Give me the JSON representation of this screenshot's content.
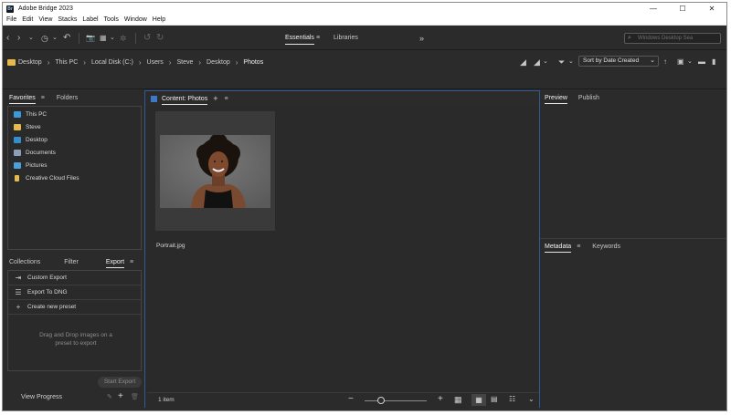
{
  "app": {
    "title": "Adobe Bridge 2023",
    "logo_text": "Br",
    "window_buttons": {
      "minimize": "—",
      "maximize": "☐",
      "close": "✕"
    }
  },
  "menu": [
    "File",
    "Edit",
    "View",
    "Stacks",
    "Label",
    "Tools",
    "Window",
    "Help"
  ],
  "workspaces": {
    "essentials": "Essentials",
    "libraries": "Libraries",
    "more": "»"
  },
  "search": {
    "placeholder": "Windows Desktop Sea"
  },
  "breadcrumbs": [
    "Desktop",
    "This PC",
    "Local Disk (C:)",
    "Users",
    "Steve",
    "Desktop",
    "Photos"
  ],
  "sort": {
    "label": "Sort by Date Created"
  },
  "left_top_panel": {
    "tabs": [
      "Favorites",
      "Folders"
    ],
    "items": [
      {
        "label": "This PC",
        "icon": "computer-icon",
        "color": "#3c9ad6"
      },
      {
        "label": "Steve",
        "icon": "folder-icon",
        "color": "#e5b94a"
      },
      {
        "label": "Desktop",
        "icon": "desktop-icon",
        "color": "#2f8fd0"
      },
      {
        "label": "Documents",
        "icon": "documents-icon",
        "color": "#8aa0b8"
      },
      {
        "label": "Pictures",
        "icon": "pictures-icon",
        "color": "#4aa0d8"
      },
      {
        "label": "Creative Cloud Files",
        "icon": "cc-folder-icon",
        "color": "#e5b94a"
      }
    ]
  },
  "left_bottom_panel": {
    "tabs": [
      "Collections",
      "Filter",
      "Export"
    ],
    "export_items": [
      {
        "label": "Custom Export",
        "icon": "export-icon"
      },
      {
        "label": "Export To DNG",
        "icon": "list-icon"
      },
      {
        "label": "Create new preset",
        "icon": "plus-icon"
      }
    ],
    "drop_hint": "Drag and Drop images on a preset to export",
    "start_export": "Start Export",
    "view_progress": "View Progress"
  },
  "content": {
    "tab": "Content: Photos",
    "thumbnail": {
      "filename": "Portrait.jpg"
    },
    "status": "1 item"
  },
  "right_panels": {
    "top_tabs": [
      "Preview",
      "Publish"
    ],
    "bottom_tabs": [
      "Metadata",
      "Keywords"
    ]
  },
  "colors": {
    "accent_blue": "#2f5b96",
    "panel_bg": "#2b2b2b",
    "folder_yellow": "#e5b94a"
  }
}
